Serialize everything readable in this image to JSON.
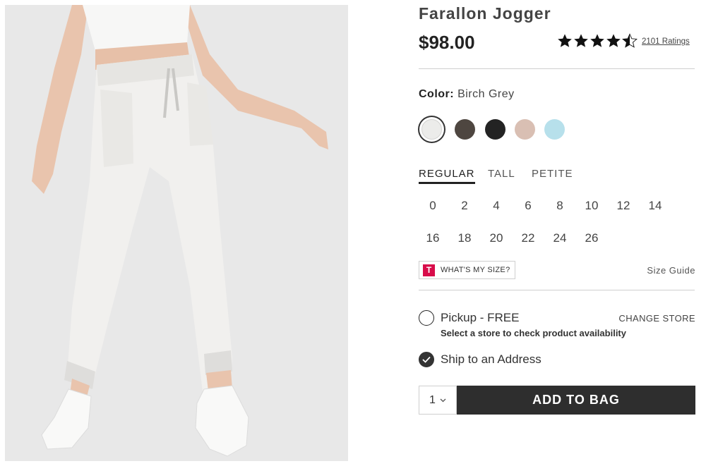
{
  "product": {
    "name": "Farallon Jogger",
    "price": "$98.00",
    "rating": 4.5,
    "ratings_link": "2101 Ratings"
  },
  "color": {
    "label": "Color:",
    "selected_name": "Birch Grey",
    "swatches": [
      {
        "name": "birch-grey",
        "hex": "#ececea"
      },
      {
        "name": "dark-brown",
        "hex": "#4e4640"
      },
      {
        "name": "black",
        "hex": "#232323"
      },
      {
        "name": "blush",
        "hex": "#d9bfb3"
      },
      {
        "name": "light-blue",
        "hex": "#b7e0eb"
      }
    ]
  },
  "fit_tabs": [
    "REGULAR",
    "TALL",
    "PETITE"
  ],
  "sizes": {
    "row1": [
      "0",
      "2",
      "4",
      "6",
      "8",
      "10",
      "12",
      "14"
    ],
    "row2": [
      "16",
      "18",
      "20",
      "22",
      "24",
      "26"
    ]
  },
  "whats_my_size": {
    "badge": "T",
    "label": "WHAT'S MY SIZE?"
  },
  "size_guide": "Size Guide",
  "fulfillment": {
    "pickup_label": "Pickup - FREE",
    "pickup_sub": "Select a store to check product availability",
    "change_store": "CHANGE STORE",
    "ship_label": "Ship to an Address"
  },
  "purchase": {
    "quantity": "1",
    "add_label": "ADD TO BAG"
  },
  "icons": {
    "rating": "star-icon",
    "quantity": "chevron-down-icon",
    "shipping": "checkmark-icon",
    "badge": "t-logo-icon"
  }
}
